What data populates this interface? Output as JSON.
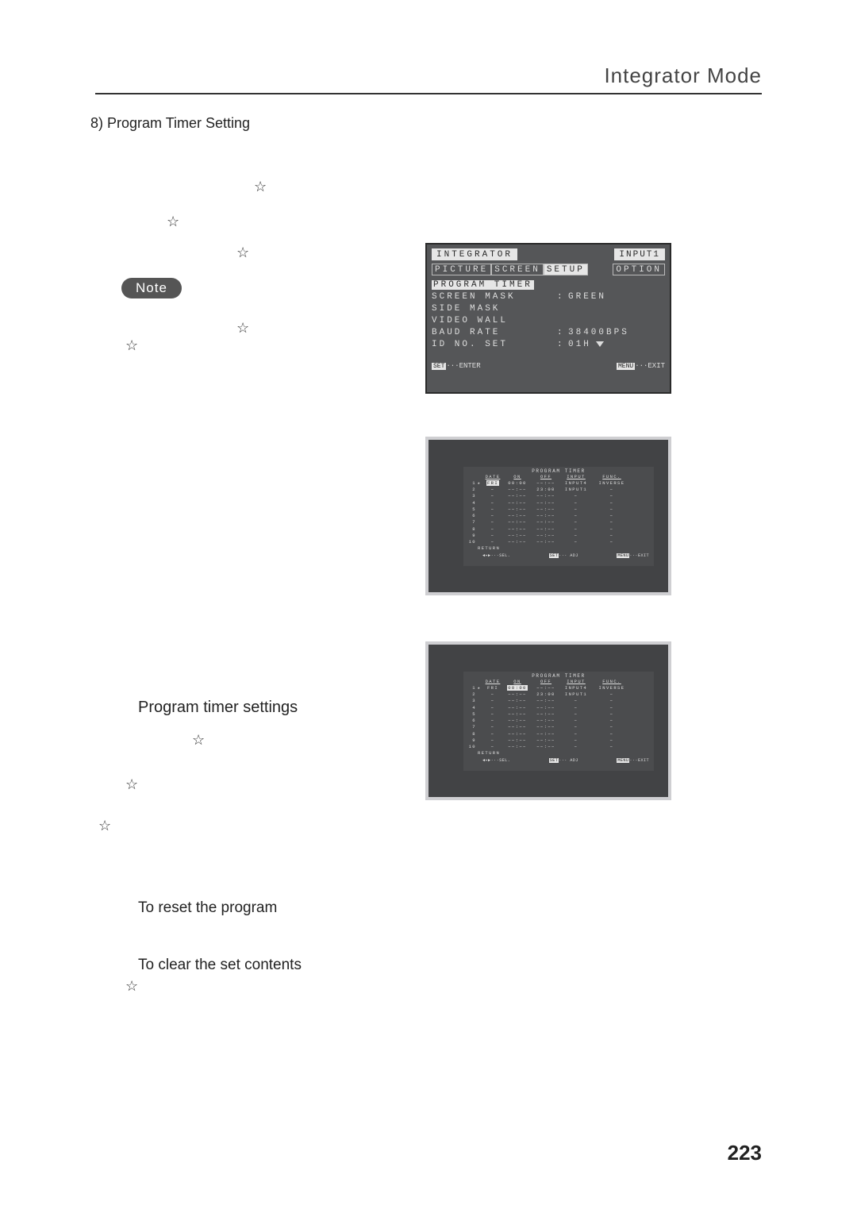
{
  "header": {
    "title": "Integrator Mode"
  },
  "section": {
    "label": "8) Program Timer Setting"
  },
  "note": {
    "label": "Note"
  },
  "left": {
    "subhead": "Program timer settings",
    "reset": "To reset the program",
    "clear": "To clear the set contents"
  },
  "osd1": {
    "title": "INTEGRATOR",
    "input": "INPUT1",
    "tabs": {
      "picture": "PICTURE",
      "screen": "SCREEN",
      "setup": "SETUP",
      "option": "OPTION"
    },
    "items": {
      "program_timer": "PROGRAM TIMER",
      "screen_mask": "SCREEN MASK",
      "screen_mask_val": "GREEN",
      "side_mask": "SIDE MASK",
      "video_wall": "VIDEO WALL",
      "baud_rate": "BAUD RATE",
      "baud_rate_val": "38400BPS",
      "id_no_set": "ID NO. SET",
      "id_no_set_val": "01H"
    },
    "footer": {
      "set": "SET",
      "enter": "···ENTER",
      "menu": "MENU",
      "exit": "···EXIT"
    },
    "colon": ":"
  },
  "pt_common": {
    "title": "PROGRAM TIMER",
    "headers": {
      "date": "DATE",
      "on": "ON",
      "off": "OFF",
      "input": "INPUT",
      "func": "FUNC."
    },
    "return": "RETURN",
    "footer": {
      "sel_glyph": "◀✦▶",
      "sel": "···SEL.",
      "set": "SET",
      "adj": "··· ADJ",
      "menu": "MENU",
      "exit": "···EXIT"
    }
  },
  "pt2_rows": [
    {
      "num": "1",
      "star": "★",
      "date": "FRI",
      "on": "00:00",
      "off": "−−:−−",
      "input": "INPUT4",
      "func": "INVERSE",
      "hl_date": true
    },
    {
      "num": "2",
      "star": "",
      "date": "−",
      "on": "−−:−−",
      "off": "23:00",
      "input": "INPUT1",
      "func": "−"
    },
    {
      "num": "3",
      "star": "",
      "date": "−",
      "on": "−−:−−",
      "off": "−−:−−",
      "input": "−",
      "func": "−"
    },
    {
      "num": "4",
      "star": "",
      "date": "−",
      "on": "−−:−−",
      "off": "−−:−−",
      "input": "−",
      "func": "−"
    },
    {
      "num": "5",
      "star": "",
      "date": "−",
      "on": "−−:−−",
      "off": "−−:−−",
      "input": "−",
      "func": "−"
    },
    {
      "num": "6",
      "star": "",
      "date": "−",
      "on": "−−:−−",
      "off": "−−:−−",
      "input": "−",
      "func": "−"
    },
    {
      "num": "7",
      "star": "",
      "date": "−",
      "on": "−−:−−",
      "off": "−−:−−",
      "input": "−",
      "func": "−"
    },
    {
      "num": "8",
      "star": "",
      "date": "−",
      "on": "−−:−−",
      "off": "−−:−−",
      "input": "−",
      "func": "−"
    },
    {
      "num": "9",
      "star": "",
      "date": "−",
      "on": "−−:−−",
      "off": "−−:−−",
      "input": "−",
      "func": "−"
    },
    {
      "num": "10",
      "star": "",
      "date": "−",
      "on": "−−:−−",
      "off": "−−:−−",
      "input": "−",
      "func": "−"
    }
  ],
  "pt3_rows": [
    {
      "num": "1",
      "star": "★",
      "date": "FRI",
      "on": "00:00",
      "off": "−−:−−",
      "input": "INPUT4",
      "func": "INVERSE",
      "hl_on": true
    },
    {
      "num": "2",
      "star": "",
      "date": "−",
      "on": "−−:−−",
      "off": "23:00",
      "input": "INPUT1",
      "func": "−"
    },
    {
      "num": "3",
      "star": "",
      "date": "−",
      "on": "−−:−−",
      "off": "−−:−−",
      "input": "−",
      "func": "−"
    },
    {
      "num": "4",
      "star": "",
      "date": "−",
      "on": "−−:−−",
      "off": "−−:−−",
      "input": "−",
      "func": "−"
    },
    {
      "num": "5",
      "star": "",
      "date": "−",
      "on": "−−:−−",
      "off": "−−:−−",
      "input": "−",
      "func": "−"
    },
    {
      "num": "6",
      "star": "",
      "date": "−",
      "on": "−−:−−",
      "off": "−−:−−",
      "input": "−",
      "func": "−"
    },
    {
      "num": "7",
      "star": "",
      "date": "−",
      "on": "−−:−−",
      "off": "−−:−−",
      "input": "−",
      "func": "−"
    },
    {
      "num": "8",
      "star": "",
      "date": "−",
      "on": "−−:−−",
      "off": "−−:−−",
      "input": "−",
      "func": "−"
    },
    {
      "num": "9",
      "star": "",
      "date": "−",
      "on": "−−:−−",
      "off": "−−:−−",
      "input": "−",
      "func": "−"
    },
    {
      "num": "10",
      "star": "",
      "date": "−",
      "on": "−−:−−",
      "off": "−−:−−",
      "input": "−",
      "func": "−"
    }
  ],
  "pagenum": "223"
}
